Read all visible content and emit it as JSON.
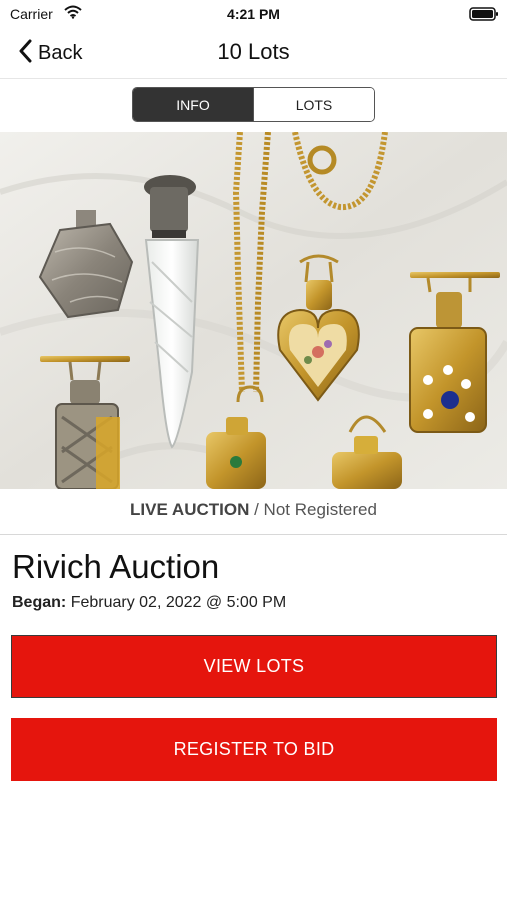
{
  "status_bar": {
    "carrier": "Carrier",
    "time": "4:21 PM"
  },
  "nav": {
    "back_label": "Back",
    "title": "10 Lots"
  },
  "tabs": [
    {
      "label": "INFO",
      "active": true
    },
    {
      "label": "LOTS",
      "active": false
    }
  ],
  "auction": {
    "status_type": "LIVE AUCTION",
    "status_sep": " / ",
    "status_reg": "Not Registered",
    "title": "Rivich Auction",
    "began_label": "Began:",
    "began_value": "February 02, 2022 @ 5:00 PM"
  },
  "buttons": {
    "view_lots": "VIEW LOTS",
    "register": "REGISTER TO BID"
  },
  "colors": {
    "accent_red": "#e5150d",
    "segment_active": "#333333"
  }
}
